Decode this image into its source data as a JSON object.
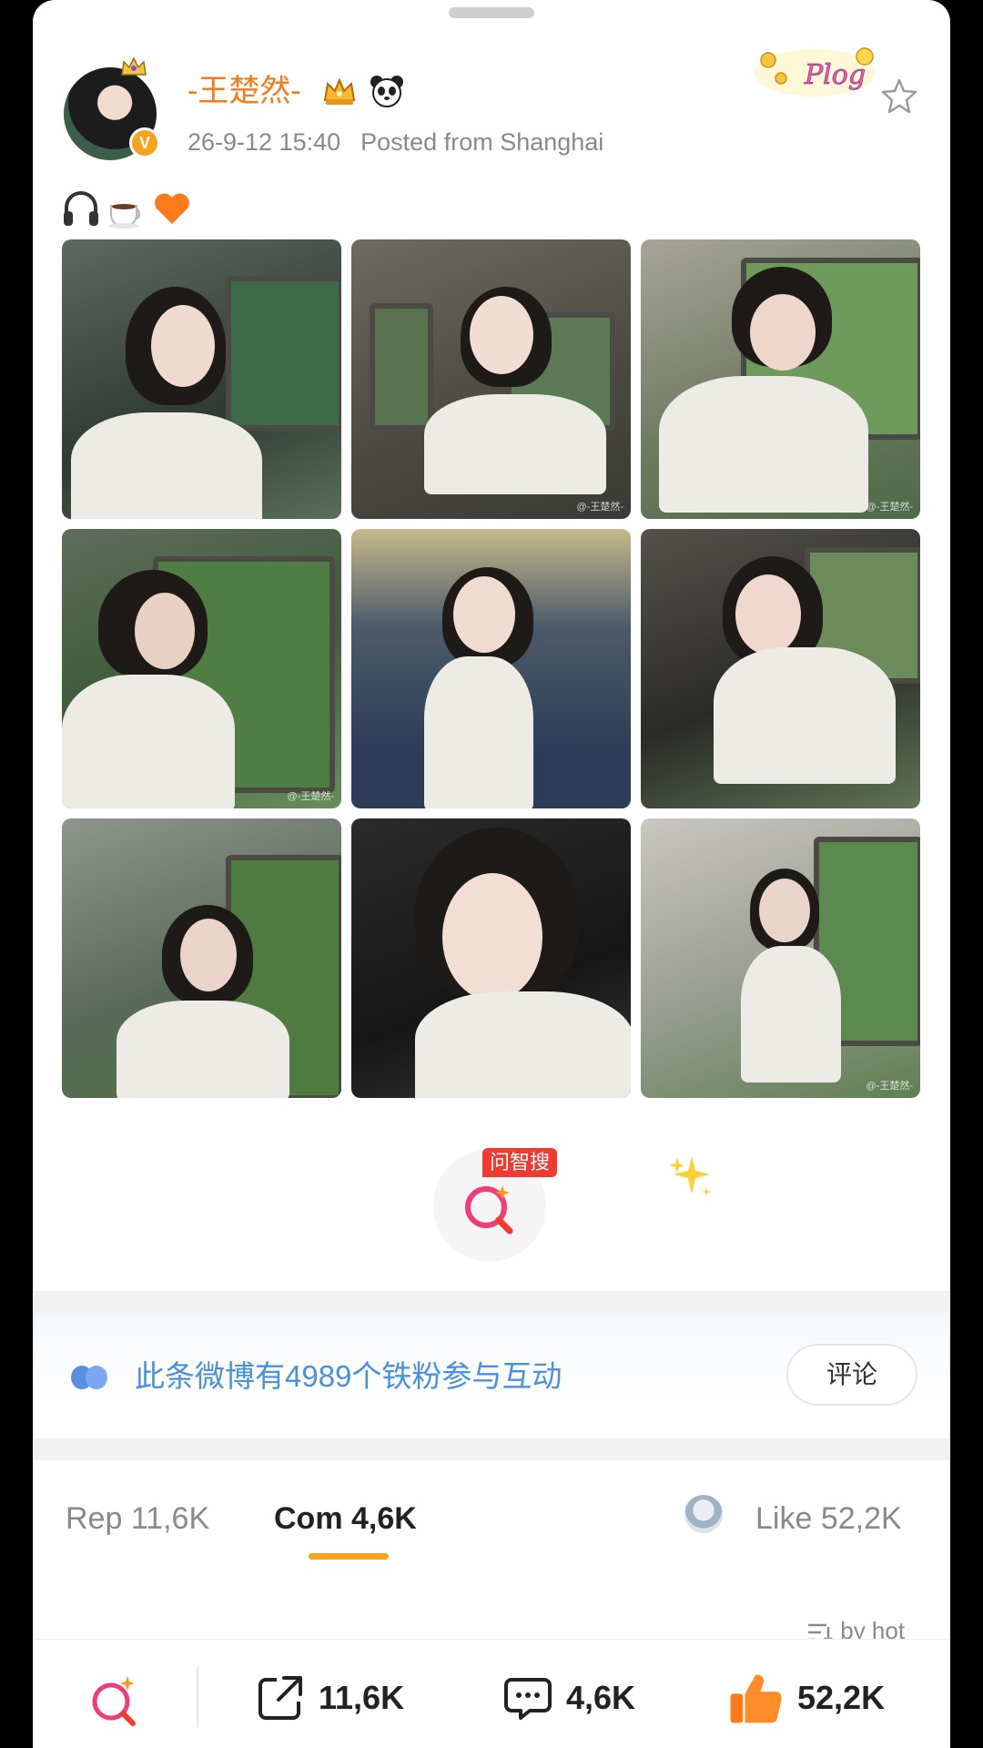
{
  "post": {
    "username": "-王楚然-",
    "timestamp": "26-9-12 15:40",
    "posted_from": "Posted from Shanghai",
    "emojis": [
      "headphones-emoji",
      "coffee-emoji",
      "orange-heart-emoji"
    ],
    "sticker_label": "Plog",
    "photo_watermark": "@-王楚然-"
  },
  "ai_search": {
    "badge": "问智搜"
  },
  "fans": {
    "text": "此条微博有4989个铁粉参与互动",
    "comment_button": "评论"
  },
  "tabs": {
    "reposts": "Rep 11,6K",
    "comments": "Com 4,6K",
    "likes": "Like 52,2K"
  },
  "sort": {
    "label": "by hot"
  },
  "bottom_bar": {
    "share_count": "11,6K",
    "comment_count": "4,6K",
    "like_count": "52,2K"
  },
  "colors": {
    "username": "#f77a16",
    "accent": "#f7a31c",
    "ai_red": "#f33a32",
    "link_blue": "#4a90e2",
    "like_orange": "#ff7a1a"
  }
}
